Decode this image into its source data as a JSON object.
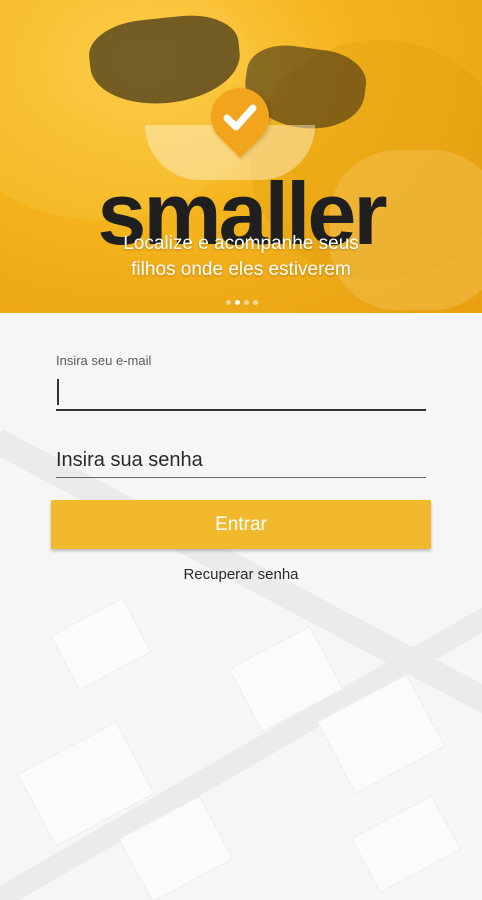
{
  "hero": {
    "logo_text": "smaller",
    "tagline_line1": "Localize e acompanhe seus",
    "tagline_line2": "filhos onde eles estiverem",
    "carousel_pages": 3,
    "carousel_active": 1,
    "brand_color": "#f4b31c"
  },
  "login": {
    "email_label": "Insira seu e-mail",
    "email_value": "",
    "password_placeholder": "Insira sua senha",
    "submit_label": "Entrar",
    "recover_link": "Recuperar senha",
    "button_color": "#f1b92d"
  }
}
